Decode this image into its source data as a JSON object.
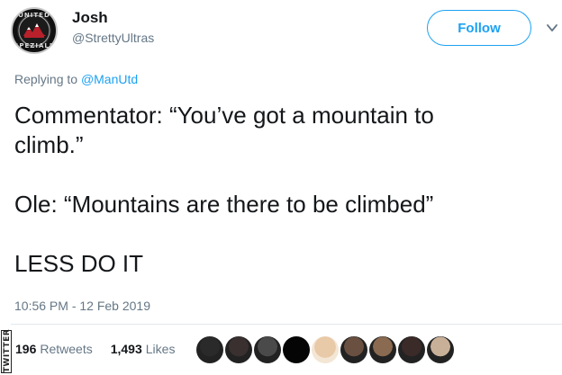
{
  "author": {
    "display_name": "Josh",
    "handle": "@StrettyUltras",
    "avatar_ring_top": "UNITED",
    "avatar_ring_bottom": "SPEZIALE"
  },
  "follow_button": {
    "label": "Follow"
  },
  "reply": {
    "prefix": "Replying to",
    "mention": "@ManUtd"
  },
  "tweet": {
    "text": "Commentator: “You’ve got a mountain to\nclimb.”\n\nOle: “Mountains are there to be climbed”\n\nLESS DO IT"
  },
  "timestamp": "10:56 PM - 12 Feb 2019",
  "stats": {
    "retweets_count": "196",
    "retweets_label": "Retweets",
    "likes_count": "1,493",
    "likes_label": "Likes"
  },
  "watermark": "TWITTER",
  "liker_avatars": [
    {
      "icon": "avatar-photo-dark",
      "color": "#2a2a2a"
    },
    {
      "icon": "avatar-photo-sunglasses",
      "color": "#3a3030"
    },
    {
      "icon": "avatar-photo-glasses",
      "color": "#4a4a4a"
    },
    {
      "icon": "avatar-photo-black",
      "color": "#050505"
    },
    {
      "icon": "avatar-photo-light",
      "color": "#e8c9a8"
    },
    {
      "icon": "avatar-photo-group",
      "color": "#6a5040"
    },
    {
      "icon": "avatar-photo-face",
      "color": "#8a6a50"
    },
    {
      "icon": "avatar-photo-crowd",
      "color": "#3a2a28"
    },
    {
      "icon": "avatar-photo-person",
      "color": "#c8b098"
    }
  ],
  "colors": {
    "accent": "#1da1f2",
    "text": "#14171a",
    "secondary": "#657786",
    "divider": "#e1e8ed"
  }
}
